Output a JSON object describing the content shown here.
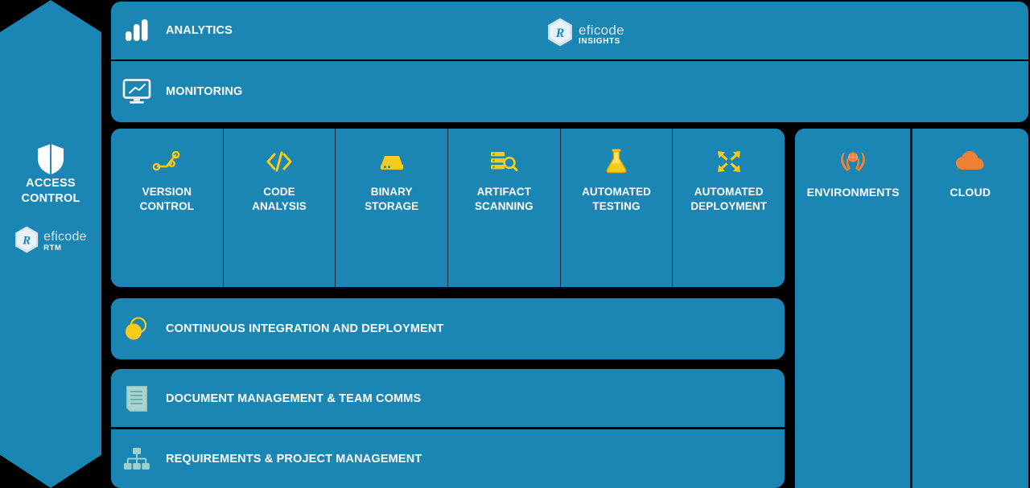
{
  "theme": {
    "background": "#000000",
    "panel_blue": "#1b86b4",
    "accent_yellow": "#f5cc19",
    "accent_orange": "#ef8136",
    "accent_pale": "#9bcfc9",
    "text_white": "#ffffff"
  },
  "access_control": {
    "icon": "shield-icon",
    "label_line1": "ACCESS",
    "label_line2": "CONTROL",
    "logo": {
      "main": "eficode",
      "sub": "RTM",
      "icon": "eficode-hex-logo-icon"
    }
  },
  "top_rows": [
    {
      "id": "analytics",
      "label": "ANALYTICS",
      "icon": "bar-chart-icon"
    },
    {
      "id": "monitoring",
      "label": "MONITORING",
      "icon": "monitor-trend-icon"
    }
  ],
  "insights_logo": {
    "main": "eficode",
    "sub": "INSIGHTS",
    "icon": "eficode-hex-logo-icon"
  },
  "tools": [
    {
      "id": "version-control",
      "label_line1": "VERSION",
      "label_line2": "CONTROL",
      "icon": "git-branch-icon"
    },
    {
      "id": "code-analysis",
      "label_line1": "CODE",
      "label_line2": "ANALYSIS",
      "icon": "code-brackets-icon"
    },
    {
      "id": "binary-storage",
      "label_line1": "BINARY",
      "label_line2": "STORAGE",
      "icon": "hard-drive-icon"
    },
    {
      "id": "artifact-scanning",
      "label_line1": "ARTIFACT",
      "label_line2": "SCANNING",
      "icon": "server-search-icon"
    },
    {
      "id": "automated-testing",
      "label_line1": "AUTOMATED",
      "label_line2": "TESTING",
      "icon": "flask-icon"
    },
    {
      "id": "automated-deployment",
      "label_line1": "AUTOMATED",
      "label_line2": "DEPLOYMENT",
      "icon": "four-arrows-icon"
    }
  ],
  "right_column": [
    {
      "id": "environments",
      "label": "ENVIRONMENTS",
      "icon": "hands-globe-icon"
    },
    {
      "id": "cloud",
      "label": "CLOUD",
      "icon": "cloud-icon"
    }
  ],
  "bottom_bars": [
    {
      "id": "cicd",
      "label": "CONTINUOUS INTEGRATION AND DEPLOYMENT",
      "icon": "overlapping-circles-icon"
    },
    {
      "id": "docs",
      "label": "DOCUMENT MANAGEMENT & TEAM COMMS",
      "icon": "document-icon"
    },
    {
      "id": "reqs",
      "label": "REQUIREMENTS & PROJECT MANAGEMENT",
      "icon": "org-chart-icon"
    }
  ]
}
